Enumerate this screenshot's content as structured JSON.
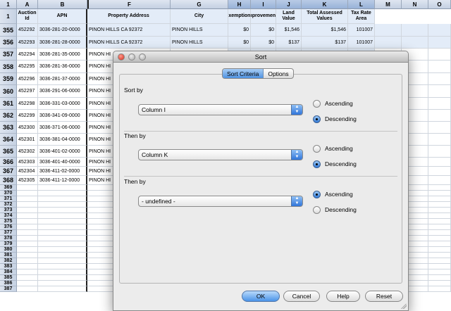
{
  "sheet": {
    "corner": "1",
    "columns": [
      {
        "letter": "A",
        "header": "Auction Id"
      },
      {
        "letter": "B",
        "header": "APN"
      },
      {
        "letter": "F",
        "header": "Property Address"
      },
      {
        "letter": "G",
        "header": "City"
      },
      {
        "letter": "H",
        "header": "Exemptions"
      },
      {
        "letter": "I",
        "header": "Improvements"
      },
      {
        "letter": "J",
        "header": "Land Value"
      },
      {
        "letter": "K",
        "header": "Total Assessed Values"
      },
      {
        "letter": "L",
        "header": "Tax Rate Area"
      },
      {
        "letter": "M",
        "header": ""
      },
      {
        "letter": "N",
        "header": ""
      },
      {
        "letter": "O",
        "header": ""
      }
    ],
    "rows": [
      {
        "num": "355",
        "id": "452292",
        "apn": "3036-281-20-0000",
        "addr": "PINON HILLS CA  92372",
        "city": "PINON HILLS",
        "ex": "$0",
        "imp": "$0",
        "land": "$1,546",
        "total": "$1,546",
        "tra": "101007"
      },
      {
        "num": "356",
        "id": "452293",
        "apn": "3036-281-28-0000",
        "addr": "PINON HILLS CA  92372",
        "city": "PINON HILLS",
        "ex": "$0",
        "imp": "$0",
        "land": "$137",
        "total": "$137",
        "tra": "101007"
      },
      {
        "num": "357",
        "id": "452294",
        "apn": "3036-281-35-0000",
        "addr": "PINON HI"
      },
      {
        "num": "358",
        "id": "452295",
        "apn": "3036-281-36-0000",
        "addr": "PINON HI"
      },
      {
        "num": "359",
        "id": "452296",
        "apn": "3036-281-37-0000",
        "addr": "PINON HI"
      },
      {
        "num": "360",
        "id": "452297",
        "apn": "3036-291-06-0000",
        "addr": "PINON HI"
      },
      {
        "num": "361",
        "id": "452298",
        "apn": "3036-331-03-0000",
        "addr": "PINON HI"
      },
      {
        "num": "362",
        "id": "452299",
        "apn": "3036-341-09-0000",
        "addr": "PINON HI"
      },
      {
        "num": "363",
        "id": "452300",
        "apn": "3036-371-06-0000",
        "addr": "PINON HI"
      },
      {
        "num": "364",
        "id": "452301",
        "apn": "3036-381-04-0000",
        "addr": "PINON HI"
      },
      {
        "num": "365",
        "id": "452302",
        "apn": "3036-401-02-0000",
        "addr": "PINON HI"
      },
      {
        "num": "366",
        "id": "452303",
        "apn": "3036-401-40-0000",
        "addr": "PINON HI"
      },
      {
        "num": "367",
        "id": "452304",
        "apn": "3036-411-02-0000",
        "addr": "PINON HI"
      },
      {
        "num": "368",
        "id": "452305",
        "apn": "3036-411-12-0000",
        "addr": "PINON HI"
      }
    ],
    "empty_rows": [
      "369",
      "370",
      "371",
      "372",
      "373",
      "374",
      "375",
      "376",
      "377",
      "378",
      "379",
      "380",
      "381",
      "382",
      "383",
      "384",
      "385",
      "386",
      "387"
    ]
  },
  "dialog": {
    "title": "Sort",
    "tabs": [
      "Sort Criteria",
      "Options"
    ],
    "groups": [
      {
        "label": "Sort by",
        "value": "Column I",
        "asc": "Ascending",
        "desc": "Descending",
        "selected": "desc"
      },
      {
        "label": "Then by",
        "value": "Column K",
        "asc": "Ascending",
        "desc": "Descending",
        "selected": "desc"
      },
      {
        "label": "Then by",
        "value": "- undefined -",
        "asc": "Ascending",
        "desc": "Descending",
        "selected": "asc"
      }
    ],
    "buttons": {
      "ok": "OK",
      "cancel": "Cancel",
      "help": "Help",
      "reset": "Reset"
    }
  }
}
